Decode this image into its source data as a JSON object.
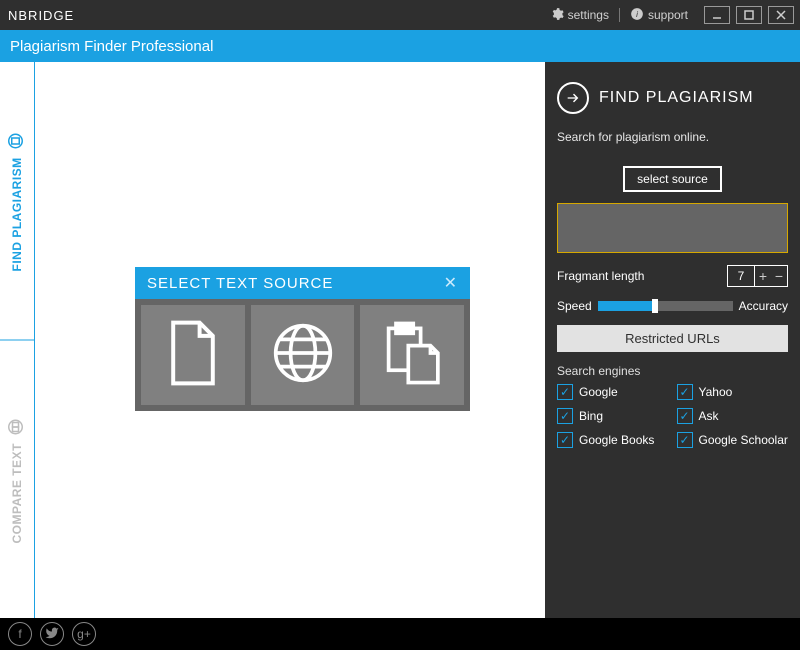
{
  "titlebar": {
    "title": "NBRIDGE",
    "settings": "settings",
    "support": "support"
  },
  "subtitle": "Plagiarism Finder Professional",
  "tabs": {
    "find": "FIND PLAGIARISM",
    "compare": "COMPARE TEXT"
  },
  "select_panel": {
    "title": "SELECT TEXT SOURCE",
    "options": {
      "file": "file-icon",
      "web": "globe-icon",
      "clipboard": "clipboard-icon"
    }
  },
  "right": {
    "heading": "FIND PLAGIARISM",
    "sub": "Search for plagiarism online.",
    "select_source": "select source",
    "fragment_label": "Fragmant length",
    "fragment_value": "7",
    "slider": {
      "left": "Speed",
      "right": "Accuracy"
    },
    "restricted": "Restricted URLs",
    "engines_label": "Search engines",
    "engines": [
      {
        "label": "Google",
        "checked": true
      },
      {
        "label": "Yahoo",
        "checked": true
      },
      {
        "label": "Bing",
        "checked": true
      },
      {
        "label": "Ask",
        "checked": true
      },
      {
        "label": "Google Books",
        "checked": true
      },
      {
        "label": "Google Schoolar",
        "checked": true
      }
    ]
  },
  "footer": {
    "facebook": "f",
    "twitter": "t",
    "gplus": "g+"
  },
  "colors": {
    "accent": "#1ba1e2"
  }
}
